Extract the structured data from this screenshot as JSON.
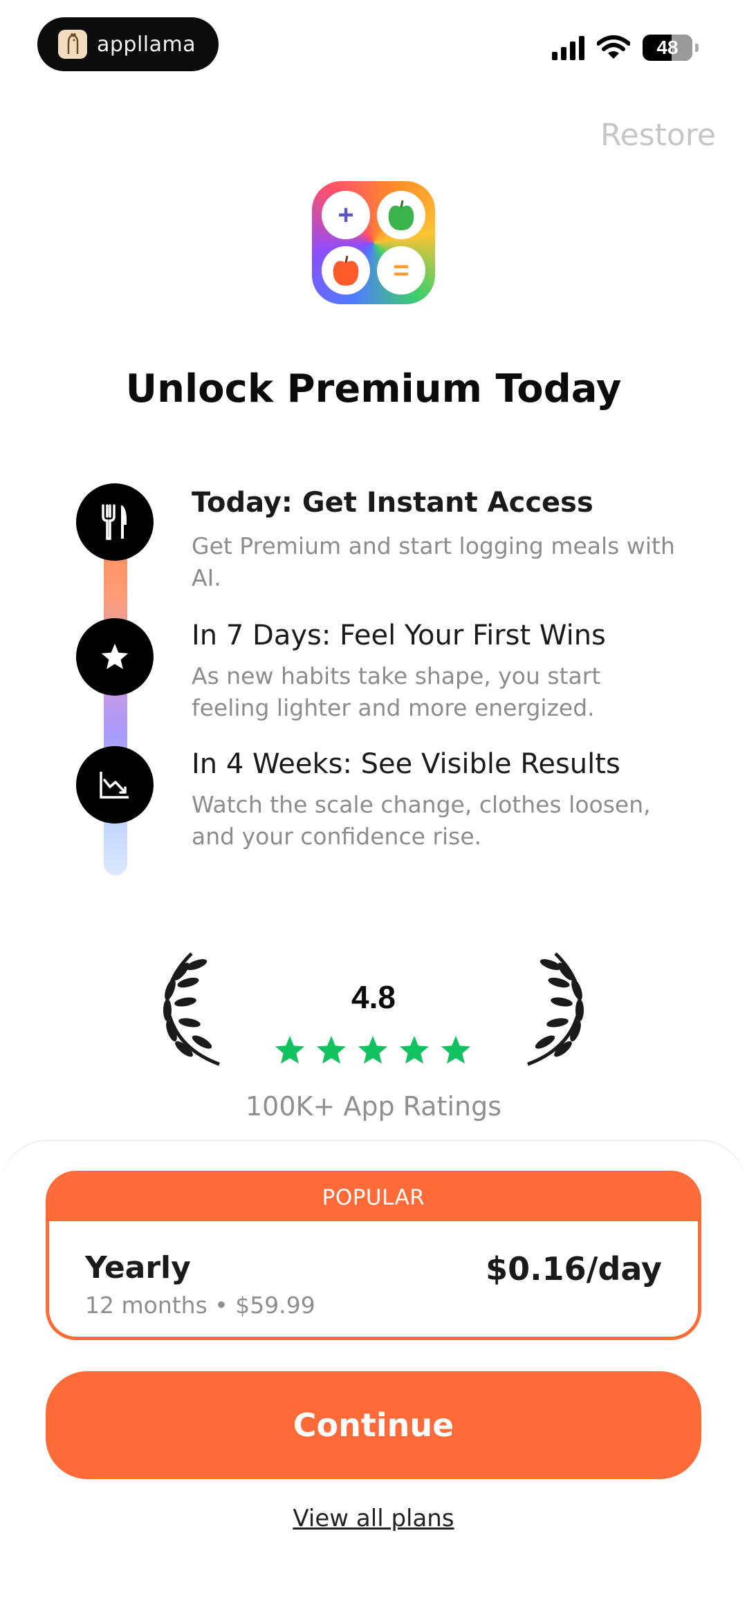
{
  "status_bar": {
    "brand_name": "appllama",
    "battery": "48"
  },
  "header": {
    "restore_label": "Restore"
  },
  "title": "Unlock Premium Today",
  "timeline": [
    {
      "icon": "utensils-icon",
      "title": "Today: Get Instant Access",
      "description": "Get Premium and start logging meals with AI."
    },
    {
      "icon": "star-icon",
      "title": "In 7 Days: Feel Your First Wins",
      "description": "As new habits take shape, you start feeling lighter and more energized."
    },
    {
      "icon": "chart-down-icon",
      "title": "In 4 Weeks: See Visible Results",
      "description": "Watch the scale change, clothes loosen, and your confidence rise."
    }
  ],
  "rating": {
    "value": "4.8",
    "stars": 5,
    "label": "100K+ App Ratings",
    "star_color": "#12c15f"
  },
  "plan": {
    "badge": "POPULAR",
    "name": "Yearly",
    "detail": "12 months • $59.99",
    "price": "$0.16/day"
  },
  "continue_label": "Continue",
  "view_all_plans_label": "View all plans",
  "colors": {
    "accent": "#ff6a39"
  }
}
